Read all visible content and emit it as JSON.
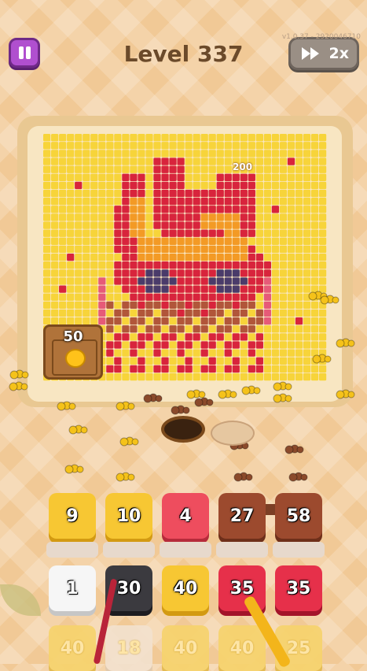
{
  "header": {
    "level_label": "Level 337",
    "speed_label": "2x",
    "version": "v1.0.37 - 2920046710"
  },
  "board": {
    "chest_value": "50",
    "floating_value": "200"
  },
  "tiles_row1": [
    {
      "value": "9",
      "color": "yellow"
    },
    {
      "value": "10",
      "color": "yellow"
    },
    {
      "value": "4",
      "color": "red"
    },
    {
      "value": "27",
      "color": "brown"
    },
    {
      "value": "58",
      "color": "brown"
    }
  ],
  "tiles_row2": [
    {
      "value": "1",
      "color": "white"
    },
    {
      "value": "30",
      "color": "dark"
    },
    {
      "value": "40",
      "color": "yellow"
    },
    {
      "value": "35",
      "color": "crimson"
    },
    {
      "value": "35",
      "color": "crimson"
    }
  ],
  "tiles_row3": [
    {
      "value": "40"
    },
    {
      "value": "18"
    },
    {
      "value": "40"
    },
    {
      "value": "40"
    },
    {
      "value": "25"
    }
  ],
  "colors": {
    "board_yellow": "#f7d43a",
    "pixel_red": "#d8243c",
    "pixel_pink": "#e65a78",
    "pixel_navy": "#4a3b6a",
    "ant_yellow": "#f5c21a",
    "ant_brown": "#8b4a2b"
  }
}
